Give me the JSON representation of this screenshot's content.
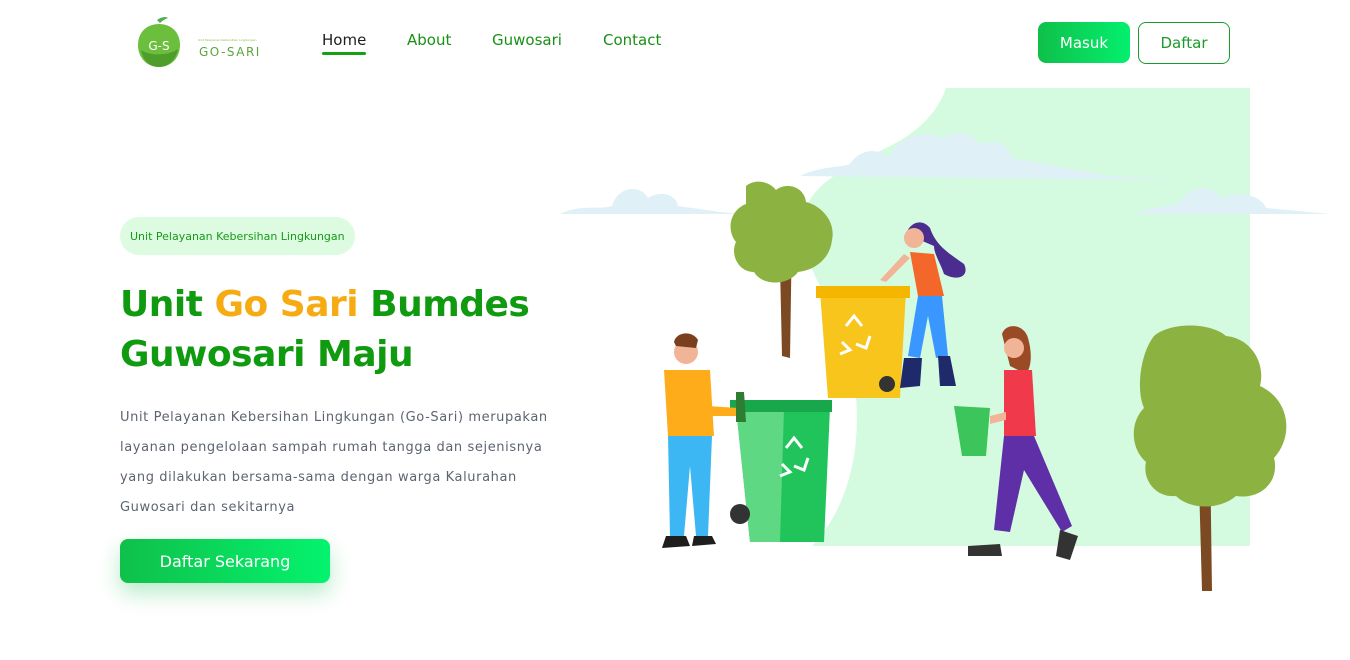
{
  "logo": {
    "mark_text": "G-S",
    "tagline": "Unit Pelayanan Kebersihan Lingkungan",
    "name": "GO-SARI"
  },
  "nav": {
    "items": [
      {
        "label": "Home",
        "active": true
      },
      {
        "label": "About",
        "active": false
      },
      {
        "label": "Guwosari",
        "active": false
      },
      {
        "label": "Contact",
        "active": false
      }
    ]
  },
  "auth": {
    "login_label": "Masuk",
    "register_label": "Daftar"
  },
  "hero": {
    "badge": "Unit Pelayanan Kebersihan Lingkungan",
    "title_part1": "Unit ",
    "title_highlight": "Go Sari",
    "title_part2": " Bumdes Guwosari Maju",
    "description": "Unit Pelayanan Kebersihan Lingkungan (Go-Sari) merupakan layanan pengelolaan sampah rumah tangga dan sejenisnya yang dilakukan bersama-sama dengan warga Kalurahan Guwosari dan sekitarnya",
    "cta_label": "Daftar Sekarang"
  },
  "colors": {
    "brand_green": "#0f9a0f",
    "accent_orange": "#f6ab12",
    "button_gradient_start": "#0fc04a",
    "button_gradient_end": "#04ef6e",
    "badge_bg": "#dcfbe1"
  },
  "icons": {
    "recycle": "recycle-icon"
  }
}
